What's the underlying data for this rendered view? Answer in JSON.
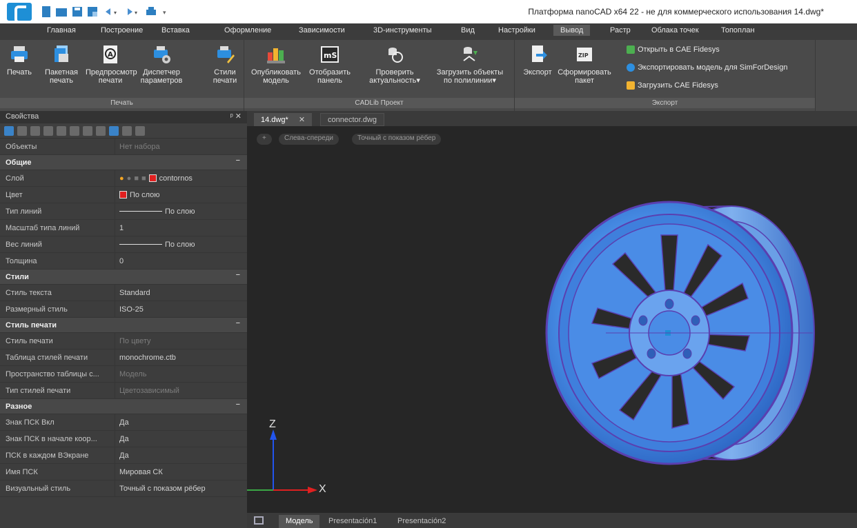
{
  "window": {
    "title": "Платформа nanoCAD x64 22 - не для коммерческого использования 14.dwg*"
  },
  "ribbon_tabs": [
    "Главная",
    "Построение",
    "Вставка",
    "Оформление",
    "Зависимости",
    "3D-инструменты",
    "Вид",
    "Настройки",
    "Вывод",
    "Растр",
    "Облака точек",
    "Топоплан"
  ],
  "ribbon_active_tab": "Вывод",
  "ribbon": {
    "print_group": {
      "label": "Печать",
      "buttons": [
        {
          "label1": "Печать",
          "label2": ""
        },
        {
          "label1": "Пакетная",
          "label2": "печать"
        },
        {
          "label1": "Предпросмотр",
          "label2": "печати"
        },
        {
          "label1": "Диспетчер",
          "label2": "параметров"
        },
        {
          "label1": "Стили",
          "label2": "печати"
        }
      ]
    },
    "cadlib_group": {
      "label": "CADLib Проект",
      "buttons": [
        {
          "label1": "Опубликовать",
          "label2": "модель"
        },
        {
          "label1": "Отобразить",
          "label2": "панель"
        },
        {
          "label1": "Проверить",
          "label2": "актуальность▾"
        },
        {
          "label1": "Загрузить объекты",
          "label2": "по полилинии▾"
        }
      ]
    },
    "export_group": {
      "label": "Экспорт",
      "buttons": [
        {
          "label1": "Экспорт",
          "label2": ""
        },
        {
          "label1": "Сформировать",
          "label2": "пакет"
        }
      ],
      "small_items": [
        "Открыть в CAE Fidesys",
        "Экспортировать модель для SimForDesign",
        "Загрузить CAE Fidesys"
      ]
    }
  },
  "properties": {
    "title": "Свойства",
    "header_controls": "ᵖ ✕",
    "objects_label": "Объекты",
    "objects_value": "Нет набора",
    "sections": {
      "general": "Общие",
      "styles": "Стили",
      "print_style": "Стиль печати",
      "misc": "Разное"
    },
    "collapse_glyph": "−",
    "rows": {
      "layer": {
        "name": "Слой",
        "value": "contornos"
      },
      "color": {
        "name": "Цвет",
        "value": "По слою"
      },
      "linetype": {
        "name": "Тип линий",
        "value": "По слою"
      },
      "linetype_scale": {
        "name": "Масштаб типа линий",
        "value": "1"
      },
      "lineweight": {
        "name": "Вес линий",
        "value": "По слою"
      },
      "thickness": {
        "name": "Толщина",
        "value": "0"
      },
      "text_style": {
        "name": "Стиль текста",
        "value": "Standard"
      },
      "dim_style": {
        "name": "Размерный стиль",
        "value": "ISO-25"
      },
      "plot_style": {
        "name": "Стиль печати",
        "value": "По цвету"
      },
      "plot_table": {
        "name": "Таблица стилей печати",
        "value": "monochrome.ctb"
      },
      "plot_table_space": {
        "name": "Пространство таблицы с...",
        "value": "Модель"
      },
      "plot_style_type": {
        "name": "Тип стилей печати",
        "value": "Цветозависимый"
      },
      "ucs_on": {
        "name": "Знак ПСК Вкл",
        "value": "Да"
      },
      "ucs_origin": {
        "name": "Знак ПСК в начале коор...",
        "value": "Да"
      },
      "ucs_each": {
        "name": "ПСК в каждом ВЭкране",
        "value": "Да"
      },
      "ucs_name": {
        "name": "Имя ПСК",
        "value": "Мировая СК"
      },
      "visual_style": {
        "name": "Визуальный стиль",
        "value": "Точный с показом рёбер"
      }
    }
  },
  "documents": {
    "tabs": [
      {
        "label": "14.dwg*",
        "close": "✕"
      },
      {
        "label": "connector.dwg",
        "close": ""
      }
    ]
  },
  "viewport": {
    "chip_plus": "+",
    "view_label": "Слева-спереди",
    "style_label": "Точный с показом рёбер",
    "axis_z": "Z",
    "axis_x": "X"
  },
  "layout_tabs": [
    "Модель",
    "Presentación1",
    "Presentación2"
  ],
  "colors": {
    "wheel_fill": "#4a90e8",
    "wheel_edge": "#5a3fb0",
    "accent_blue": "#1e8fd6",
    "layer_red": "#e02020"
  }
}
